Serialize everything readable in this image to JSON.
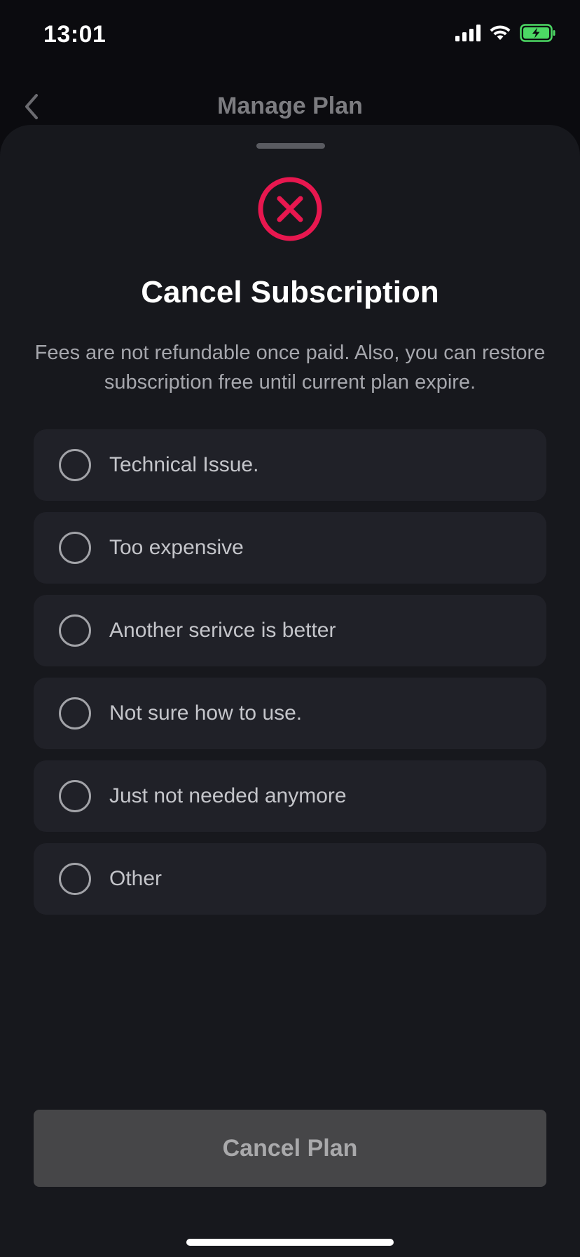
{
  "status_bar": {
    "time": "13:01",
    "icons": [
      "cellular-signal-icon",
      "wifi-icon",
      "battery-charging-icon"
    ],
    "battery_color": "#4cd964"
  },
  "nav": {
    "title": "Manage Plan",
    "back_icon": "chevron-left-icon"
  },
  "sheet": {
    "icon": "cancel-circle-icon",
    "accent_color": "#e8174f",
    "title": "Cancel Subscription",
    "description": "Fees are not refundable once paid. Also, you can restore subscription free until current plan expire.",
    "options": [
      {
        "label": "Technical Issue.",
        "selected": false
      },
      {
        "label": "Too expensive",
        "selected": false
      },
      {
        "label": "Another serivce is better",
        "selected": false
      },
      {
        "label": "Not sure how to use.",
        "selected": false
      },
      {
        "label": "Just not needed anymore",
        "selected": false
      },
      {
        "label": "Other",
        "selected": false
      }
    ],
    "cancel_button_label": "Cancel Plan"
  }
}
